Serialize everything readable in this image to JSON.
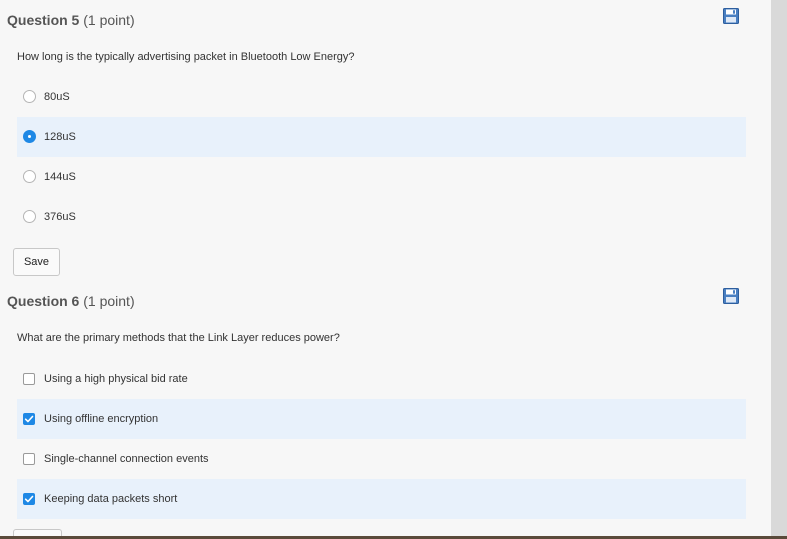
{
  "questions": [
    {
      "number_label": "Question 5",
      "points_label": "(1 point)",
      "prompt": "How long is the typically advertising packet in Bluetooth Low Energy?",
      "type": "single-choice",
      "options": [
        {
          "label": "80uS",
          "selected": false
        },
        {
          "label": "128uS",
          "selected": true
        },
        {
          "label": "144uS",
          "selected": false
        },
        {
          "label": "376uS",
          "selected": false
        }
      ],
      "save_label": "Save"
    },
    {
      "number_label": "Question 6",
      "points_label": "(1 point)",
      "prompt": "What are the primary methods that the Link Layer reduces power?",
      "type": "multiple-choice",
      "options": [
        {
          "label": "Using a high physical bid rate",
          "selected": false
        },
        {
          "label": "Using offline encryption",
          "selected": true
        },
        {
          "label": "Single-channel connection events",
          "selected": false
        },
        {
          "label": "Keeping data packets short",
          "selected": true
        }
      ]
    }
  ],
  "colors": {
    "accent": "#1e88e5",
    "selected_row": "#e8f1fb",
    "page_background": "#f7f7f7"
  },
  "icons": {
    "save": "floppy-disk-icon"
  }
}
